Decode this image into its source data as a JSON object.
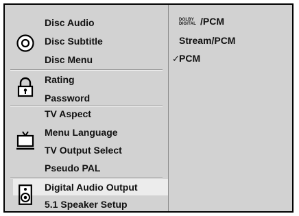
{
  "menu": {
    "groups": [
      {
        "icon": "disc-icon",
        "items": [
          {
            "label": "Disc Audio"
          },
          {
            "label": "Disc Subtitle"
          },
          {
            "label": "Disc Menu"
          }
        ]
      },
      {
        "icon": "lock-icon",
        "items": [
          {
            "label": "Rating"
          },
          {
            "label": "Password"
          }
        ]
      },
      {
        "icon": "tv-icon",
        "items": [
          {
            "label": "TV Aspect"
          },
          {
            "label": "Menu Language"
          },
          {
            "label": "TV Output Select"
          },
          {
            "label": "Pseudo PAL"
          }
        ]
      },
      {
        "icon": "speaker-icon",
        "items": [
          {
            "label": "Digital Audio Output",
            "selected": true
          },
          {
            "label": "5.1 Speaker Setup"
          }
        ]
      }
    ]
  },
  "options": {
    "dolby_line1": "DOLBY",
    "dolby_line2": "DIGITAL",
    "items": [
      {
        "label": "/PCM"
      },
      {
        "label": "Stream/PCM"
      },
      {
        "label": "PCM",
        "checked": true
      }
    ],
    "check_mark": "✓"
  }
}
